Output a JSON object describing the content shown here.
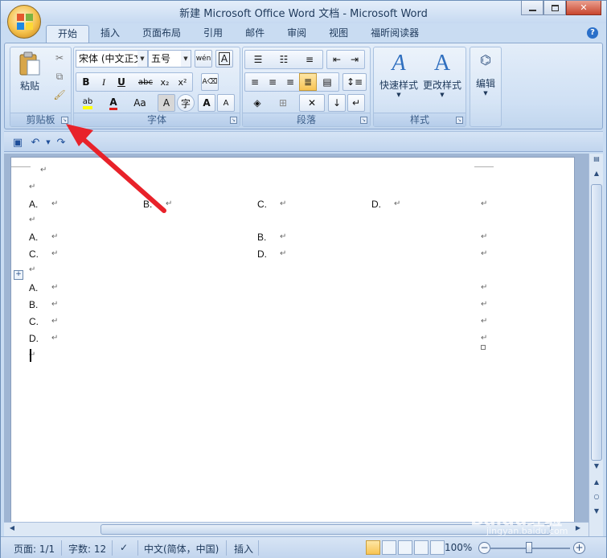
{
  "window": {
    "title": "新建 Microsoft Office Word 文档 - Microsoft Word"
  },
  "tabs": [
    "开始",
    "插入",
    "页面布局",
    "引用",
    "邮件",
    "审阅",
    "视图",
    "福昕阅读器"
  ],
  "ribbon": {
    "clipboard": {
      "label": "剪贴板",
      "paste": "粘贴"
    },
    "font": {
      "label": "字体",
      "font_name": "宋体 (中文正文",
      "font_size": "五号",
      "bold": "B",
      "italic": "I",
      "underline": "U",
      "strike": "abc",
      "subscript": "x₂",
      "superscript": "x²",
      "grow": "A",
      "shrink": "A",
      "case": "Aa",
      "char_shading": "A",
      "enclose": "字"
    },
    "paragraph": {
      "label": "段落"
    },
    "styles": {
      "label": "样式",
      "quick": "快速样式",
      "change": "更改样式"
    },
    "editing": {
      "label": "编辑"
    }
  },
  "document": {
    "rows": [
      [
        "A.",
        "B.",
        "C.",
        "D."
      ],
      [
        "A.",
        "B."
      ],
      [
        "C.",
        "D."
      ],
      [
        "A."
      ],
      [
        "B."
      ],
      [
        "C."
      ],
      [
        "D."
      ]
    ]
  },
  "status": {
    "page": "页面: 1/1",
    "words": "字数: 12",
    "language": "中文(简体，中国)",
    "mode": "插入",
    "zoom": "100%"
  },
  "watermark": {
    "main": "Baidu经验",
    "sub": "jingyan.baidu.com"
  },
  "colors": {
    "annotation": "#e8222a",
    "accent": "#1e395b"
  }
}
